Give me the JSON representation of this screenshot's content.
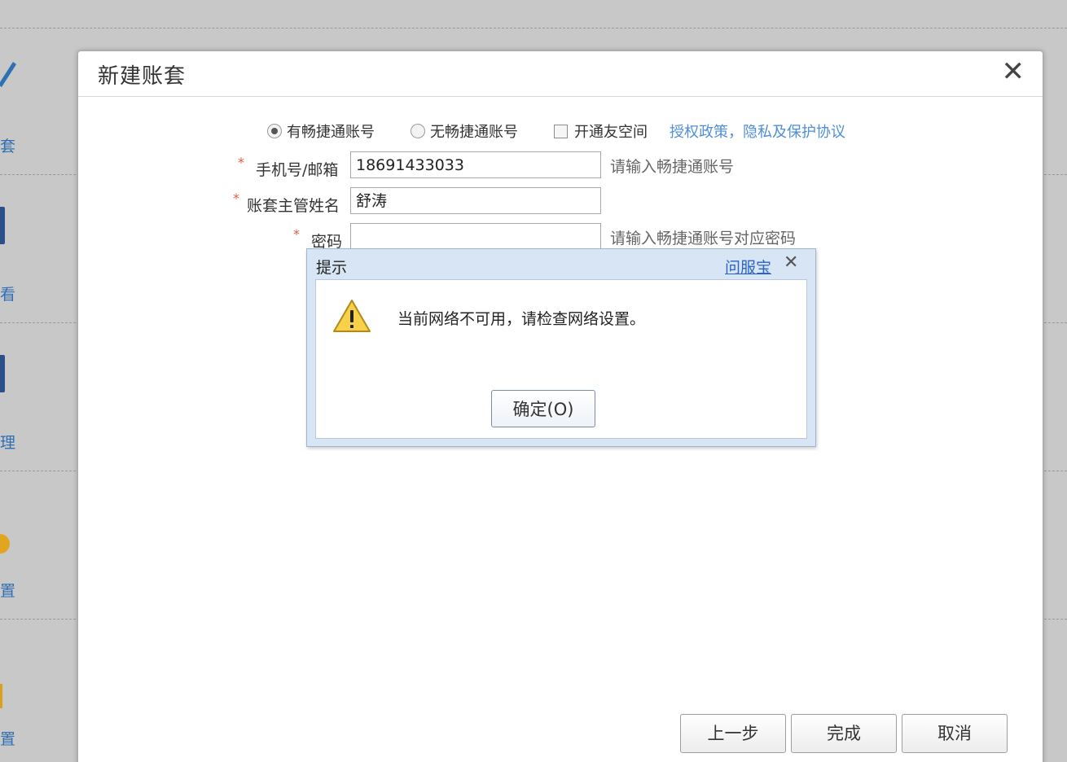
{
  "background_nav": {
    "items": [
      {
        "label": "套"
      },
      {
        "label": "看"
      },
      {
        "label": "理"
      },
      {
        "label": "置"
      },
      {
        "label": "置"
      }
    ]
  },
  "modal": {
    "title": "新建账套",
    "close": "✕",
    "options": {
      "has_account": "有畅捷通账号",
      "no_account": "无畅捷通账号",
      "open_space": "开通友空间",
      "policy_link": "授权政策，隐私及保护协议",
      "selected": "has_account"
    },
    "fields": {
      "phone": {
        "required": "*",
        "label": "手机号/邮箱",
        "value": "18691433033",
        "hint": "请输入畅捷通账号"
      },
      "manager": {
        "required": "*",
        "label": "账套主管姓名",
        "value": "舒涛"
      },
      "password": {
        "required": "*",
        "label": "密码",
        "value": "",
        "hint": "请输入畅捷通账号对应密码"
      }
    },
    "buttons": {
      "prev": "上一步",
      "finish": "完成",
      "cancel": "取消"
    }
  },
  "alert": {
    "title": "提示",
    "help_link": "问服宝",
    "close": "✕",
    "message": "当前网络不可用，请检查网络设置。",
    "ok_label": "确定(O)"
  },
  "colors": {
    "link": "#4f8ed8",
    "required": "#e45a3b",
    "alert_frame": "#d7e5f4"
  }
}
